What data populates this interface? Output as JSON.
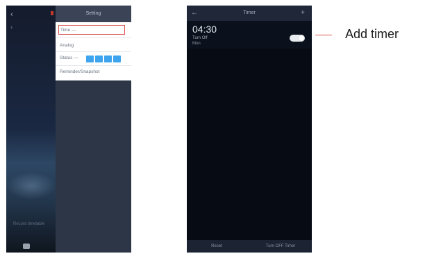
{
  "left_phone": {
    "back_icon": "chevron-left-icon",
    "caption": "Record timetable",
    "setting_panel": {
      "title": "Setting",
      "rows": {
        "time": "Time —",
        "analog": "Analog",
        "status": "Status —",
        "reminder": "Reminder/Snapshot"
      }
    }
  },
  "right_phone": {
    "title": "Timer",
    "back_icon": "arrow-left-icon",
    "add_icon": "plus-icon",
    "timer": {
      "time": "04:30",
      "action": "Turn Off",
      "repeat": "Mon",
      "enabled": true
    },
    "bottom": {
      "reset": "Reset",
      "turn_off_all": "Turn OFF Timer"
    }
  },
  "annotation": {
    "label": "Add timer",
    "color": "#d9534f"
  }
}
